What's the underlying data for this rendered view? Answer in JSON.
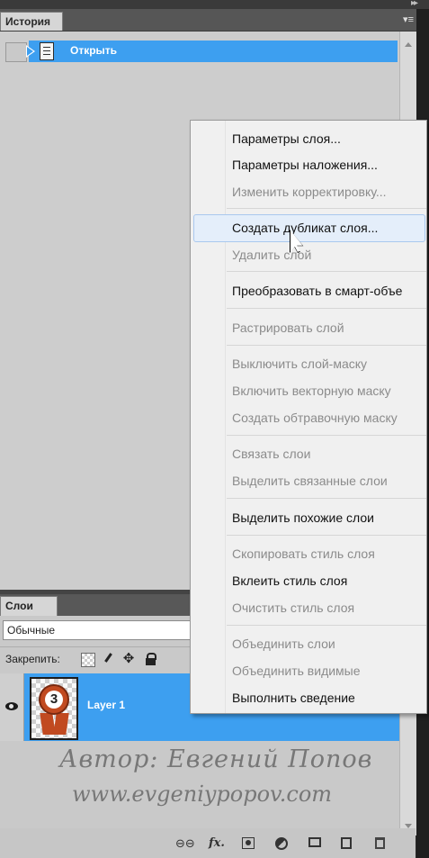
{
  "history_panel": {
    "tab_label": "История",
    "state_label": "Открыть"
  },
  "context_menu": {
    "items": [
      {
        "label": "Параметры слоя...",
        "enabled": true
      },
      {
        "label": "Параметры наложения...",
        "enabled": true
      },
      {
        "label": "Изменить корректировку...",
        "enabled": false
      },
      {
        "label": "Создать дубликат слоя...",
        "enabled": true,
        "hovered": true
      },
      {
        "label": "Удалить слой",
        "enabled": false
      },
      {
        "label": "Преобразовать в смарт-объе",
        "enabled": true
      },
      {
        "label": "Растрировать слой",
        "enabled": false
      },
      {
        "label": "Выключить слой-маску",
        "enabled": false
      },
      {
        "label": "Включить векторную маску",
        "enabled": false
      },
      {
        "label": "Создать обтравочную маску",
        "enabled": false
      },
      {
        "label": "Связать слои",
        "enabled": false
      },
      {
        "label": "Выделить связанные слои",
        "enabled": false
      },
      {
        "label": "Выделить похожие слои",
        "enabled": true
      },
      {
        "label": "Скопировать стиль слоя",
        "enabled": false
      },
      {
        "label": "Вклеить стиль слоя",
        "enabled": true
      },
      {
        "label": "Очистить стиль слоя",
        "enabled": false
      },
      {
        "label": "Объединить слои",
        "enabled": false
      },
      {
        "label": "Объединить видимые",
        "enabled": false
      },
      {
        "label": "Выполнить сведение",
        "enabled": true
      }
    ]
  },
  "layers_panel": {
    "tab_label": "Слои",
    "blend_mode": "Обычные",
    "lock_label": "Закрепить:",
    "layer_name": "Layer 1",
    "thumbnail_number": "3",
    "bottom_icons": [
      "link-icon",
      "fx-icon",
      "mask-icon",
      "adjustment-icon",
      "folder-icon",
      "new-layer-icon",
      "trash-icon"
    ],
    "bottom_fx_label": "fx."
  },
  "watermark": {
    "line1": "Автор: Евгений Попов",
    "line2": "www.evgeniypopov.com"
  },
  "colors": {
    "selection": "#3d9ff0",
    "menu_bg": "#f0f0f0",
    "panel_bg": "#cdcdcd"
  }
}
